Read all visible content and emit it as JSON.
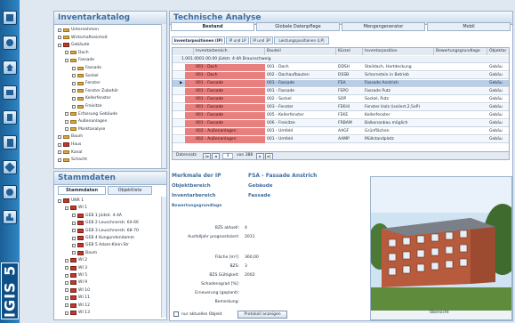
{
  "rail": {
    "logo": "IGIS 5",
    "icons": [
      "database-icon",
      "people-icon",
      "home-icon",
      "monitor-icon",
      "calculator-icon",
      "document-icon",
      "contract-icon",
      "search-icon",
      "chart-icon"
    ]
  },
  "catalog": {
    "title": "Inventarkatalog",
    "items": [
      {
        "label": "Unternehmen",
        "level": 0,
        "icon": "org"
      },
      {
        "label": "Wirtschaftseinheit",
        "level": 0,
        "icon": "org"
      },
      {
        "label": "Gebäude",
        "level": 0,
        "icon": "bld"
      },
      {
        "label": "Dach",
        "level": 1,
        "icon": "fold"
      },
      {
        "label": "Fassade",
        "level": 1,
        "icon": "fold"
      },
      {
        "label": "Fassade",
        "level": 2,
        "icon": "fold"
      },
      {
        "label": "Sockel",
        "level": 2,
        "icon": "fold"
      },
      {
        "label": "Fenster",
        "level": 2,
        "icon": "fold"
      },
      {
        "label": "Fenster Zubehör",
        "level": 2,
        "icon": "fold"
      },
      {
        "label": "Kellerfenster",
        "level": 2,
        "icon": "fold"
      },
      {
        "label": "Freisitze",
        "level": 2,
        "icon": "fold"
      },
      {
        "label": "Erfassung Gebäude",
        "level": 1,
        "icon": "fold"
      },
      {
        "label": "Außenanlagen",
        "level": 1,
        "icon": "fold"
      },
      {
        "label": "Marktanalyse",
        "level": 1,
        "icon": "fold"
      },
      {
        "label": "Baum",
        "level": 0,
        "icon": "tree"
      },
      {
        "label": "Haus",
        "level": 0,
        "icon": "bld"
      },
      {
        "label": "Kanal",
        "level": 0,
        "icon": "line"
      },
      {
        "label": "Schacht",
        "level": 0,
        "icon": "line"
      }
    ]
  },
  "stamm": {
    "title": "Stammdaten",
    "tabs": [
      "Stammdaten",
      "Objektliste"
    ],
    "items": [
      {
        "label": "UNR 1",
        "level": 0
      },
      {
        "label": "WI 1",
        "level": 1
      },
      {
        "label": "GEB 1 Jüdstr. 4-4A",
        "level": 2
      },
      {
        "label": "GEB 2 Leuschnerstr. 64-66",
        "level": 2
      },
      {
        "label": "GEB 3 Leuschnerstr. 68-70",
        "level": 2
      },
      {
        "label": "GEB 4 Kungundendamm",
        "level": 2
      },
      {
        "label": "GEB 5 Adam-Klein-Str",
        "level": 2
      },
      {
        "label": "Baum",
        "level": 2
      },
      {
        "label": "WI 2",
        "level": 1
      },
      {
        "label": "WI 3",
        "level": 1
      },
      {
        "label": "WI 5",
        "level": 1
      },
      {
        "label": "WI 9",
        "level": 1
      },
      {
        "label": "WI 10",
        "level": 1
      },
      {
        "label": "WI 11",
        "level": 1
      },
      {
        "label": "WI 12",
        "level": 1
      },
      {
        "label": "WI 13",
        "level": 1
      }
    ]
  },
  "analysis": {
    "title": "Technische Analyse",
    "tabs": [
      "Bestand",
      "Globale Datenpflege",
      "Mengengenerator",
      "Mobil"
    ],
    "subtabs": [
      "Inventarpositionen (IP)",
      "IP und LP",
      "IP und 3P",
      "Leistungspositionen (LP)"
    ],
    "columns": [
      "Inventarbereich",
      "Bauteil",
      "Kürzel",
      "Inventarposition",
      "Bewertungsgrundlage",
      "Objektar"
    ],
    "group": "1.001.0001.00.00 Jüdstr. 4-4A Braunschweig",
    "rows": [
      [
        "001 - Dach",
        "001 - Dach",
        "DDSH",
        "Steildach, Hartdeckung",
        "",
        "Gebäu"
      ],
      [
        "001 - Dach",
        "002 - Dachaufbauten",
        "DSSB",
        "Schornstein in Betrieb",
        "",
        "Gebäu"
      ],
      [
        "001 - Fassade",
        "001 - Fassade",
        "FSA",
        "Fassade Anstrich",
        "",
        "Gebäu"
      ],
      [
        "001 - Fassade",
        "001 - Fassade",
        "FSPO",
        "Fassade Putz",
        "",
        "Gebäu"
      ],
      [
        "001 - Fassade",
        "002 - Sockel",
        "SOP",
        "Sockel, Putz",
        "",
        "Gebäu"
      ],
      [
        "001 - Fassade",
        "003 - Fenster",
        "FEKHI",
        "Fenster Holz (isoliert.2,5eP)",
        "",
        "Gebäu"
      ],
      [
        "001 - Fassade",
        "005 - Kellerfenster",
        "FEKE",
        "Kellerfenster",
        "",
        "Gebäu"
      ],
      [
        "001 - Fassade",
        "006 - Freisitze",
        "FRBAM",
        "Balkonanbau möglich",
        "",
        "Gebäu"
      ],
      [
        "002 - Außenanlagen",
        "001 - Umfeld",
        "AAGF",
        "Grünflächen",
        "",
        "Gebäu"
      ],
      [
        "002 - Außenanlagen",
        "001 - Umfeld",
        "AAMP",
        "Müllstandplatz",
        "",
        "Gebäu"
      ]
    ],
    "footer": {
      "label": "Datensatz",
      "current": "3",
      "of": "von 388"
    }
  },
  "detail": {
    "heading_left": "Merkmale der IP",
    "heading_right": "FSA - Fassade Anstrich",
    "objbereich_label": "Objektbereich",
    "objbereich_val": "Gebäude",
    "invbereich_label": "Inventarbereich",
    "invbereich_val": "Fassade",
    "section": "Bewertungsgrundlage",
    "fields": [
      {
        "label": "BZS aktuell:",
        "value": "4"
      },
      {
        "label": "Ausfalljahr prognostiziert:",
        "value": "2011"
      },
      {
        "label": "Fläche [m²]:",
        "value": "360,00"
      },
      {
        "label": "BZS:",
        "value": "3"
      },
      {
        "label": "BZS Gültigkeit:",
        "value": "2002"
      },
      {
        "label": "Schadensgrad [%]:",
        "value": ""
      },
      {
        "label": "Erneuerung (geplant):",
        "value": ""
      },
      {
        "label": "Bemerkung:",
        "value": ""
      }
    ],
    "checkbox": "nur aktuelles Objekt",
    "button": "Protokoll anzeigen"
  },
  "photo": {
    "caption": "Übersicht"
  }
}
